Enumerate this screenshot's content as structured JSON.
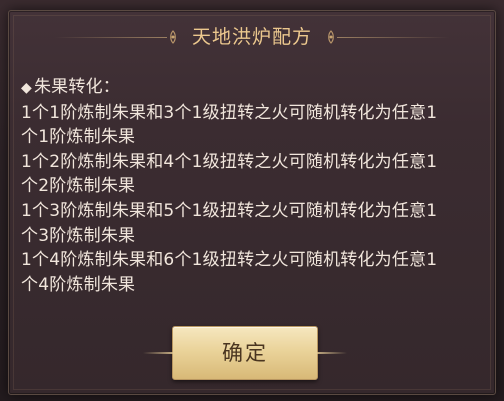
{
  "dialog": {
    "title": "天地洪炉配方",
    "section_heading": "朱果转化：",
    "rules": [
      "1个1阶炼制朱果和3个1级扭转之火可随机转化为任意1",
      "个1阶炼制朱果",
      "1个2阶炼制朱果和4个1级扭转之火可随机转化为任意1",
      "个2阶炼制朱果",
      "1个3阶炼制朱果和5个1级扭转之火可随机转化为任意1",
      "个3阶炼制朱果",
      "1个4阶炼制朱果和6个1级扭转之火可随机转化为任意1",
      "个4阶炼制朱果"
    ],
    "confirm_label": "确定"
  },
  "colors": {
    "title": "#ecc88e",
    "body_text": "#f1e6dc",
    "panel": "#3b2c31",
    "button": "#ead39a"
  }
}
